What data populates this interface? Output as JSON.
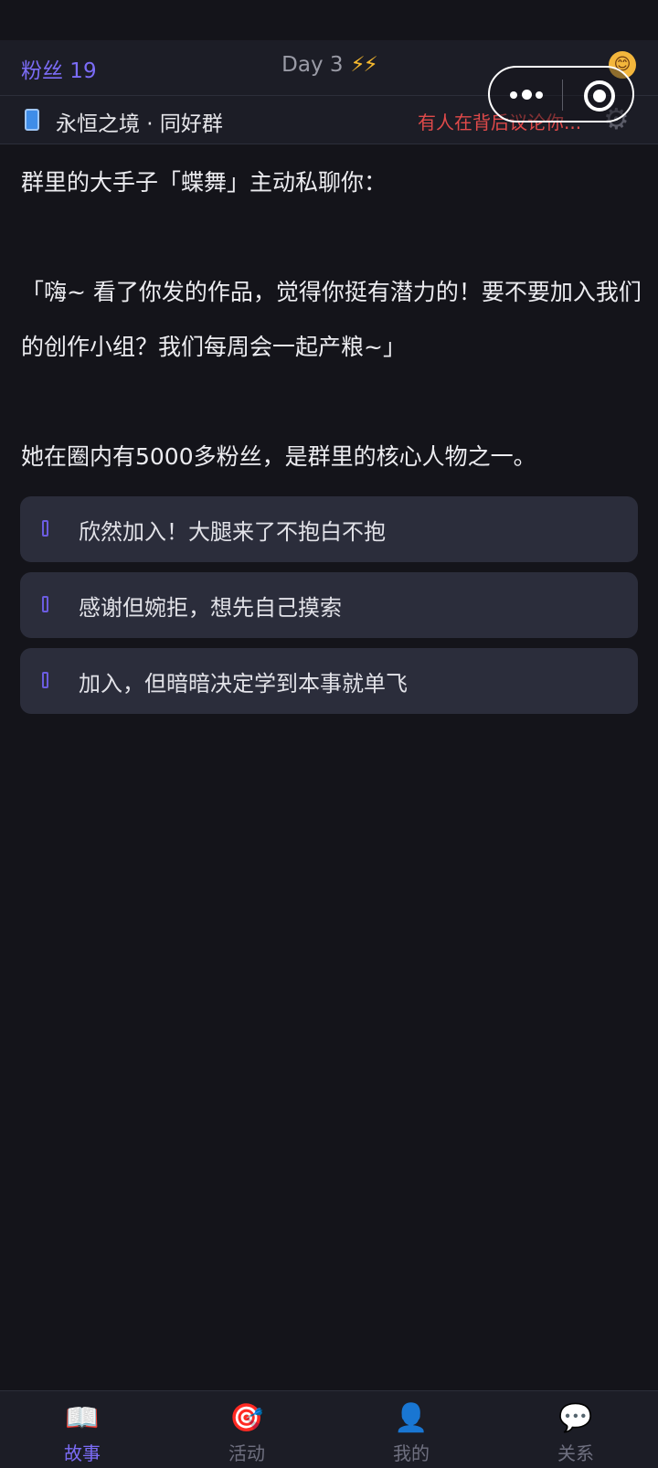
{
  "header": {
    "fans_label": "粉丝 19",
    "day_label": "Day 3",
    "energy": "⚡⚡",
    "mood_icon": "😊"
  },
  "subheader": {
    "group_name": "永恒之境 · 同好群",
    "rumor_text": "有人在背后议论你...",
    "settings_icon": "⚙"
  },
  "story": {
    "paragraphs": [
      "群里的大手子「蝶舞」主动私聊你：",
      "「嗨~ 看了你发的作品，觉得你挺有潜力的！要不要加入我们的创作小组？我们每周会一起产粮~」",
      "她在圈内有5000多粉丝，是群里的核心人物之一。"
    ]
  },
  "choices": [
    {
      "label": "欣然加入！大腿来了不抱白不抱"
    },
    {
      "label": "感谢但婉拒，想先自己摸索"
    },
    {
      "label": "加入，但暗暗决定学到本事就单飞"
    }
  ],
  "tabs": [
    {
      "icon": "📖",
      "label": "故事"
    },
    {
      "icon": "🎯",
      "label": "活动"
    },
    {
      "icon": "👤",
      "label": "我的"
    },
    {
      "icon": "💬",
      "label": "关系"
    }
  ],
  "colors": {
    "accent": "#7b6cf6",
    "warning": "#e04a4a",
    "energy": "#f5b82e",
    "background": "#14141a",
    "card": "#2b2d3b"
  }
}
